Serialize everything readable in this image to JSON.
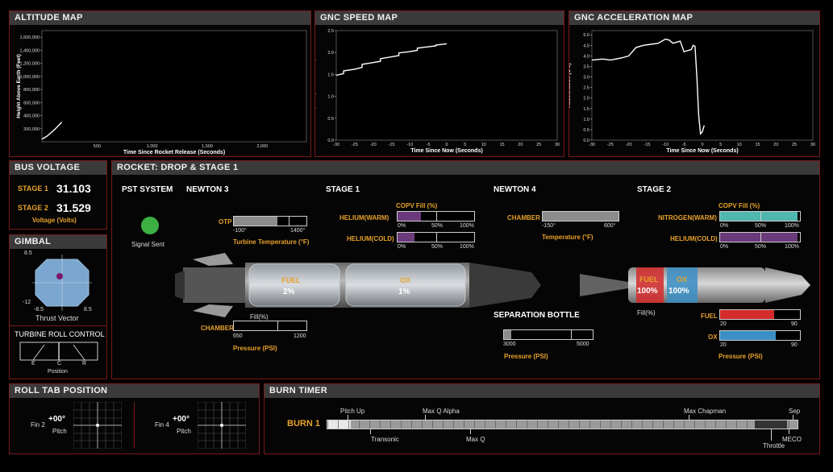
{
  "altitude": {
    "title": "ALTITUDE MAP",
    "ylabel": "Height Above Earth (Feet)",
    "xlabel": "Time Since Rocket Release (Seconds)",
    "yticks": [
      "200,000",
      "400,000",
      "600,000",
      "800,000",
      "1,000,000",
      "1,200,000",
      "1,400,000",
      "1,600,000"
    ],
    "xticks": [
      "500",
      "1,000",
      "1,500",
      "2,000"
    ]
  },
  "speed": {
    "title": "GNC SPEED MAP",
    "ylabel": "Speed (Miles/Second)",
    "xlabel": "Time Since Now (Seconds)",
    "yticks": [
      "0.0",
      "0.5",
      "1.0",
      "1.5",
      "2.0",
      "2.5"
    ],
    "xticks": [
      "-30",
      "-25",
      "-20",
      "-15",
      "-10",
      "-5",
      "0",
      "5",
      "10",
      "15",
      "20",
      "25",
      "30"
    ]
  },
  "accel": {
    "title": "GNC ACCELERATION MAP",
    "ylabel": "Acceleration (G's)",
    "xlabel": "Time Since Now (Seconds)",
    "yticks": [
      "0.0",
      "0.5",
      "1.0",
      "1.5",
      "2.0",
      "2.5",
      "3.0",
      "3.5",
      "4.0",
      "4.5",
      "5.0"
    ],
    "xticks": [
      "-30",
      "-25",
      "-20",
      "-15",
      "-10",
      "-5",
      "0",
      "5",
      "10",
      "15",
      "20",
      "25",
      "30"
    ]
  },
  "chart_data": [
    {
      "type": "line",
      "title": "ALTITUDE MAP",
      "xlabel": "Time Since Rocket Release (Seconds)",
      "ylabel": "Height Above Earth (Feet)",
      "xlim": [
        0,
        2400
      ],
      "ylim": [
        0,
        1700000
      ],
      "x": [
        0,
        20,
        40,
        60,
        80,
        100,
        120,
        140,
        160,
        180
      ],
      "y": [
        40000,
        60000,
        80000,
        105000,
        135000,
        165000,
        195000,
        230000,
        265000,
        300000
      ]
    },
    {
      "type": "line",
      "title": "GNC SPEED MAP",
      "xlabel": "Time Since Now (Seconds)",
      "ylabel": "Speed (Miles/Second)",
      "xlim": [
        -30,
        30
      ],
      "ylim": [
        0,
        2.5
      ],
      "x": [
        -30,
        -28,
        -28,
        -25,
        -23,
        -23,
        -20,
        -18,
        -18,
        -15,
        -13,
        -13,
        -10,
        -8,
        -8,
        -5,
        -3,
        -3,
        0
      ],
      "y": [
        1.48,
        1.52,
        1.58,
        1.62,
        1.66,
        1.73,
        1.77,
        1.8,
        1.86,
        1.9,
        1.93,
        1.99,
        2.02,
        2.05,
        2.1,
        2.13,
        2.15,
        2.17,
        2.2
      ]
    },
    {
      "type": "line",
      "title": "GNC ACCELERATION MAP",
      "xlabel": "Time Since Now (Seconds)",
      "ylabel": "Acceleration (G's)",
      "xlim": [
        -30,
        30
      ],
      "ylim": [
        0,
        5.2
      ],
      "x": [
        -30,
        -27,
        -25,
        -22,
        -20,
        -18,
        -16,
        -14,
        -12,
        -10,
        -9,
        -8,
        -6,
        -5,
        -3,
        -2.5,
        -2,
        -1.5,
        -1,
        -0.5,
        0,
        0.5
      ],
      "y": [
        3.8,
        3.85,
        3.8,
        3.9,
        4.0,
        4.4,
        4.5,
        4.55,
        4.6,
        4.8,
        4.75,
        4.6,
        4.7,
        4.2,
        4.3,
        4.5,
        4.45,
        3.0,
        1.2,
        0.3,
        0.4,
        0.7
      ]
    }
  ],
  "bus": {
    "title": "BUS VOLTAGE",
    "stage1_label": "STAGE 1",
    "stage1_value": "31.103",
    "stage2_label": "STAGE 2",
    "stage2_value": "31.529",
    "unit_label": "Voltage (Volts)"
  },
  "gimbal": {
    "title": "GIMBAL",
    "y_top": "8.5",
    "y_bottom": "-12",
    "x_left": "-8.5",
    "x_right": "8.5",
    "caption": "Thrust Vector"
  },
  "turbine": {
    "title": "TURBINE ROLL CONTROL",
    "e_label": "E",
    "c_label": "C",
    "r_label": "R",
    "caption": "Position"
  },
  "rocket": {
    "title": "ROCKET: DROP & STAGE 1",
    "pst_label": "PST SYSTEM",
    "signal_label": "Signal Sent",
    "signal_color": "#3cb043",
    "newton3": {
      "title": "NEWTON 3",
      "otp_label": "OTP",
      "otp_min": "-100°",
      "otp_max": "1400°",
      "otp_caption": "Turbine Temperature (°F)",
      "otp_level": 0.6,
      "fill_caption": "Fill(%)",
      "chamber_label": "CHAMBER",
      "chamber_min": "650",
      "chamber_max": "1200",
      "chamber_caption": "Pressure (PSI)"
    },
    "stage1": {
      "title": "STAGE 1",
      "copv_label": "COPV Fill (%)",
      "helium_warm_label": "HELIUM(WARM)",
      "helium_warm_level": 0.3,
      "helium_cold_label": "HELIUM(COLD)",
      "helium_cold_level": 0.22,
      "t0": "0%",
      "t50": "50%",
      "t100": "100%",
      "fuel_label": "FUEL",
      "fuel_value": "2%",
      "ox_label": "OX",
      "ox_value": "1%"
    },
    "newton4": {
      "title": "NEWTON 4",
      "chamber_label": "CHAMBER",
      "chamber_min": "-150°",
      "chamber_max": "600°",
      "chamber_caption": "Temperature (°F)",
      "chamber_level": 1.0,
      "sep_label": "SEPARATION BOTTLE",
      "sep_min": "3000",
      "sep_max": "5000",
      "sep_caption": "Pressure (PSI)",
      "sep_level": 0.08
    },
    "stage2": {
      "title": "STAGE 2",
      "copv_label": "COPV Fill (%)",
      "nitrogen_label": "NITROGEN(WARM)",
      "nitrogen_level": 0.97,
      "helium_cold_label": "HELIUM(COLD)",
      "helium_cold_level": 0.97,
      "t0": "0%",
      "t50": "50%",
      "t100": "100%",
      "fuel_label": "FUEL",
      "fuel_value": "100%",
      "ox_label": "OX",
      "ox_value": "100%",
      "fill_caption": "Fill(%)",
      "fuel_p_label": "FUEL",
      "fuel_p_level": 0.68,
      "ox_p_label": "OX",
      "ox_p_level": 0.7,
      "p_min": "20",
      "p_max": "90",
      "p_caption": "Pressure (PSI)",
      "fuel_color": "#d42a2a",
      "ox_color": "#3a8fc4"
    }
  },
  "roll": {
    "title": "ROLL TAB POSITION",
    "fin2_label": "Fin 2",
    "fin2_value": "+00°",
    "fin2_caption": "Pitch",
    "fin4_label": "Fin 4",
    "fin4_value": "+00°",
    "fin4_caption": "Pitch"
  },
  "burn": {
    "title": "BURN TIMER",
    "burn_label": "BURN 1",
    "progress": 0.05,
    "events_top": [
      "Pitch Up",
      "Max Q Alpha",
      "Max Chapman",
      "Sep"
    ],
    "events_bottom": [
      "Transonic",
      "Max Q",
      "Throttle",
      "MECO"
    ]
  }
}
